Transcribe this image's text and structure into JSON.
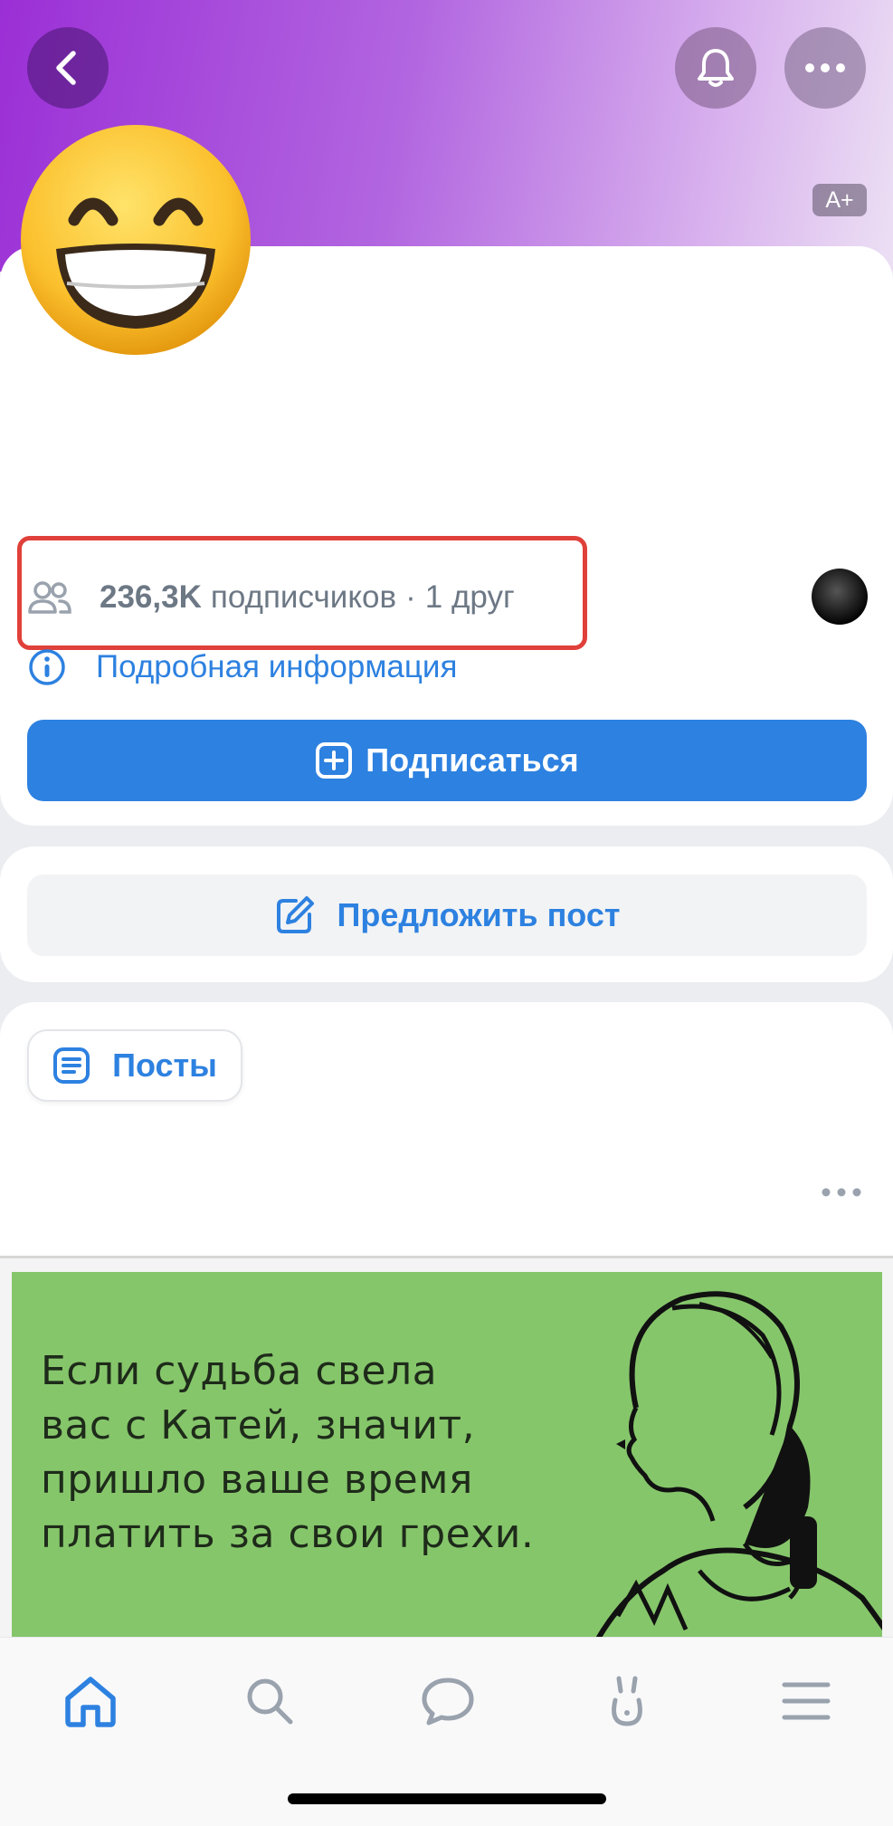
{
  "header": {
    "back_icon": "chevron-left-icon",
    "bell_icon": "bell-icon",
    "more_icon": "ellipsis-icon",
    "text_size_badge": "A+"
  },
  "profile": {
    "avatar": "grinning-emoji-avatar",
    "subscribers_count": "236,3K",
    "subscribers_label": "подписчиков",
    "separator": "·",
    "friends": "1 друг",
    "info_link": "Подробная информация",
    "subscribe_button": "Подписаться"
  },
  "actions": {
    "suggest_post": "Предложить пост"
  },
  "feed": {
    "posts_tab": "Посты",
    "post": {
      "image_text_lines": [
        "Если судьба свела",
        "вас с Катей, значит,",
        "пришло ваше время",
        "платить за свои грехи."
      ]
    }
  },
  "tabbar": {
    "items": [
      "home-icon",
      "search-icon",
      "messages-icon",
      "clips-icon",
      "menu-icon"
    ],
    "active": "home-icon"
  },
  "colors": {
    "accent": "#2d81e0",
    "highlight": "#e0403a",
    "cover_start": "#9b2fd6",
    "post_bg": "#86c66b"
  }
}
